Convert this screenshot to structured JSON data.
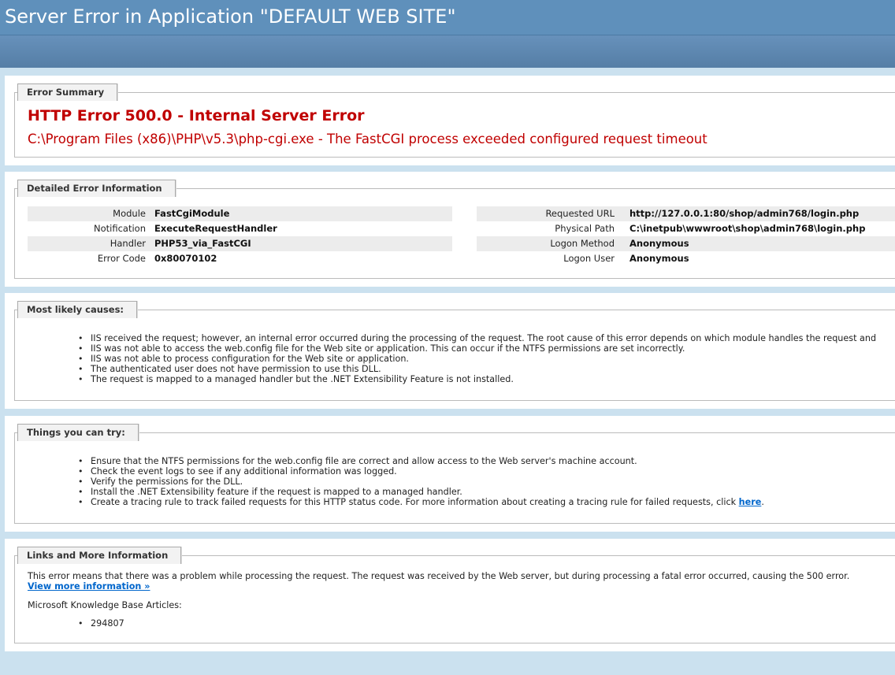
{
  "header": {
    "title": "Server Error in Application \"DEFAULT WEB SITE\""
  },
  "summary": {
    "tab": "Error Summary",
    "title": "HTTP Error 500.0 - Internal Server Error",
    "detail": "C:\\Program Files (x86)\\PHP\\v5.3\\php-cgi.exe - The FastCGI process exceeded configured request timeout"
  },
  "detail": {
    "tab": "Detailed Error Information",
    "left": [
      {
        "label": "Module",
        "value": "FastCgiModule"
      },
      {
        "label": "Notification",
        "value": "ExecuteRequestHandler"
      },
      {
        "label": "Handler",
        "value": "PHP53_via_FastCGI"
      },
      {
        "label": "Error Code",
        "value": "0x80070102"
      }
    ],
    "right": [
      {
        "label": "Requested URL",
        "value": "http://127.0.0.1:80/shop/admin768/login.php"
      },
      {
        "label": "Physical Path",
        "value": "C:\\inetpub\\wwwroot\\shop\\admin768\\login.php"
      },
      {
        "label": "Logon Method",
        "value": "Anonymous"
      },
      {
        "label": "Logon User",
        "value": "Anonymous"
      }
    ]
  },
  "causes": {
    "tab": "Most likely causes:",
    "items": [
      "IIS received the request; however, an internal error occurred during the processing of the request. The root cause of this error depends on which module handles the request and",
      "IIS was not able to access the web.config file for the Web site or application. This can occur if the NTFS permissions are set incorrectly.",
      "IIS was not able to process configuration for the Web site or application.",
      "The authenticated user does not have permission to use this DLL.",
      "The request is mapped to a managed handler but the .NET Extensibility Feature is not installed."
    ]
  },
  "try": {
    "tab": "Things you can try:",
    "items": [
      "Ensure that the NTFS permissions for the web.config file are correct and allow access to the Web server's machine account.",
      "Check the event logs to see if any additional information was logged.",
      "Verify the permissions for the DLL.",
      "Install the .NET Extensibility feature if the request is mapped to a managed handler."
    ],
    "last_prefix": "Create a tracing rule to track failed requests for this HTTP status code. For more information about creating a tracing rule for failed requests, click ",
    "last_link": "here",
    "last_suffix": "."
  },
  "links": {
    "tab": "Links and More Information",
    "text": "This error means that there was a problem while processing the request. The request was received by the Web server, but during processing a fatal error occurred, causing the 500 error.",
    "more_link": "View more information »",
    "kb_label": "Microsoft Knowledge Base Articles:",
    "kb_items": [
      "294807"
    ]
  }
}
